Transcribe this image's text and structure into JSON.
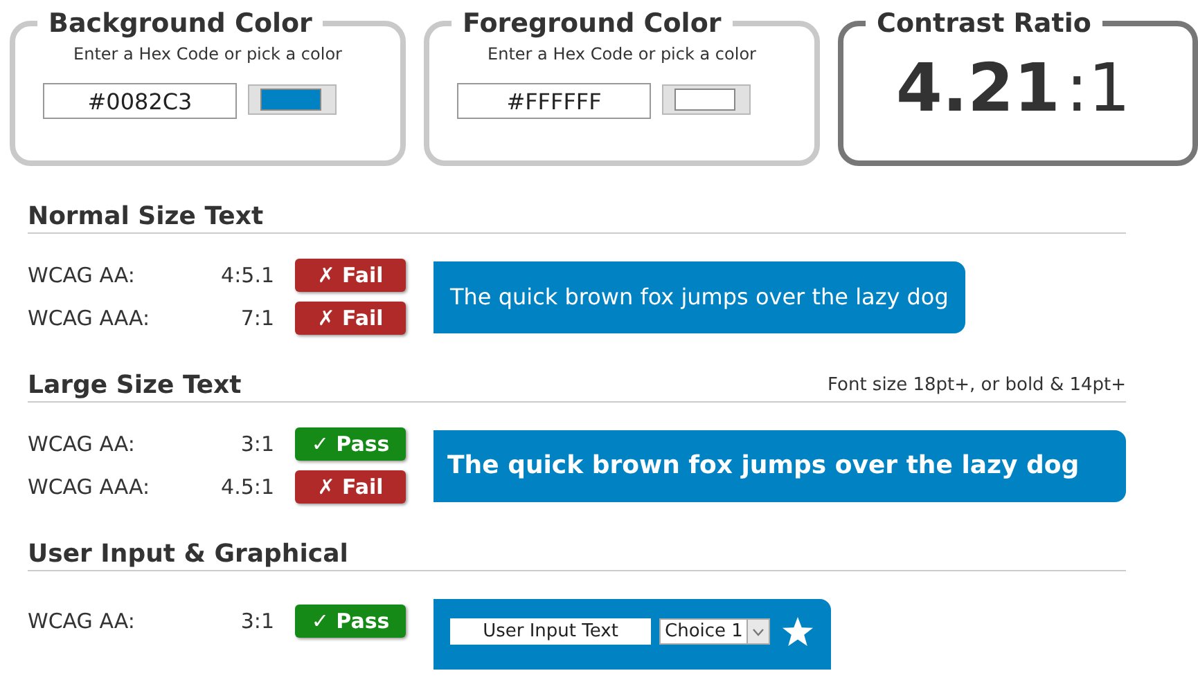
{
  "pickers": [
    {
      "title": "Background Color",
      "hint": "Enter a Hex Code or pick a color",
      "value": "#0082C3",
      "color": "#0082c3"
    },
    {
      "title": "Foreground Color",
      "hint": "Enter a Hex Code or pick a color",
      "value": "#FFFFFF",
      "color": "#ffffff"
    }
  ],
  "contrast": {
    "title": "Contrast Ratio",
    "ratio": "4.21",
    "suffix": ":1"
  },
  "sections": [
    {
      "title": "Normal Size Text",
      "kind": "normal",
      "sample": "The quick brown fox jumps over the lazy dog",
      "rows": [
        {
          "label": "WCAG AA:",
          "ratio": "4:5.1",
          "passed": false,
          "badge": "✗ Fail"
        },
        {
          "label": "WCAG AAA:",
          "ratio": "7:1",
          "passed": false,
          "badge": "✗ Fail"
        }
      ]
    },
    {
      "title": "Large Size Text",
      "note": "Font size 18pt+, or bold & 14pt+",
      "kind": "large",
      "sample": "The quick brown fox jumps over the lazy dog",
      "rows": [
        {
          "label": "WCAG AA:",
          "ratio": "3:1",
          "passed": true,
          "badge": "✓ Pass"
        },
        {
          "label": "WCAG AAA:",
          "ratio": "4.5:1",
          "passed": false,
          "badge": "✗ Fail"
        }
      ]
    },
    {
      "title": "User Input & Graphical",
      "kind": "ui",
      "input": "User Input Text",
      "select": "Choice 1",
      "rows": [
        {
          "label": "WCAG AA:",
          "ratio": "3:1",
          "passed": true,
          "badge": "✓ Pass"
        }
      ]
    }
  ]
}
